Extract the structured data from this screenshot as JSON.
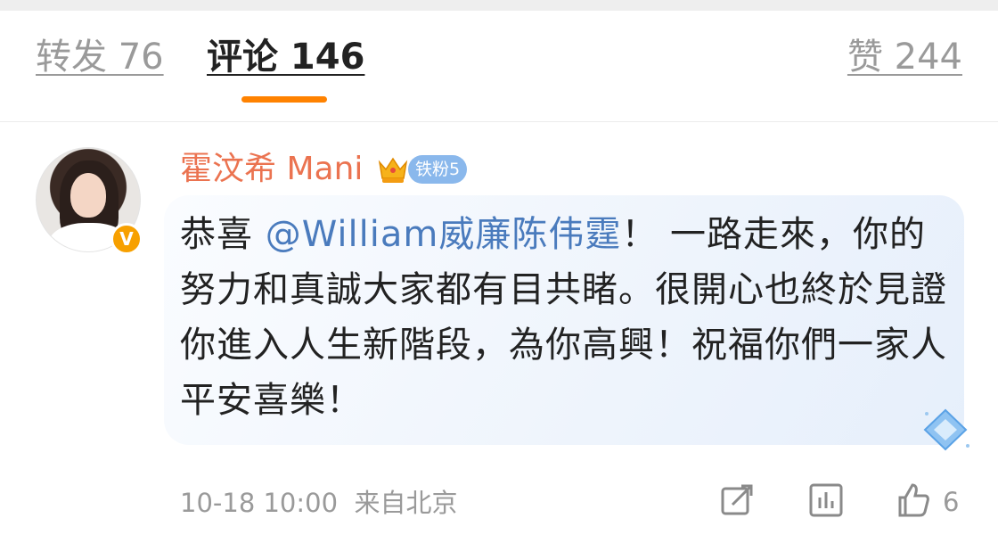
{
  "tabs": {
    "repost": "转发 76",
    "comment": "评论 146",
    "like": "赞 244"
  },
  "comment": {
    "username": "霍汶希 Mani",
    "fan_badge": "铁粉5",
    "text_prefix": "恭喜 ",
    "mention": "@William威廉陈伟霆",
    "text_body": "！ 一路走來，你的努力和真誠大家都有目共睹。很開心也終於見證你進入人生新階段，為你高興！祝福你們一家人平安喜樂！",
    "time": "10-18 10:00",
    "source": "来自北京",
    "like_count": "6"
  },
  "colors": {
    "accent": "#ff8200",
    "username": "#eb7350",
    "mention": "#4a7bbd",
    "fan_badge": "#8ab8ec",
    "verified": "#f7a000"
  },
  "icons": {
    "crown": "crown-icon",
    "verified": "verified-v-icon",
    "diamond": "diamond-icon",
    "share": "share-icon",
    "stats": "stats-icon",
    "thumb": "thumbs-up-icon"
  }
}
